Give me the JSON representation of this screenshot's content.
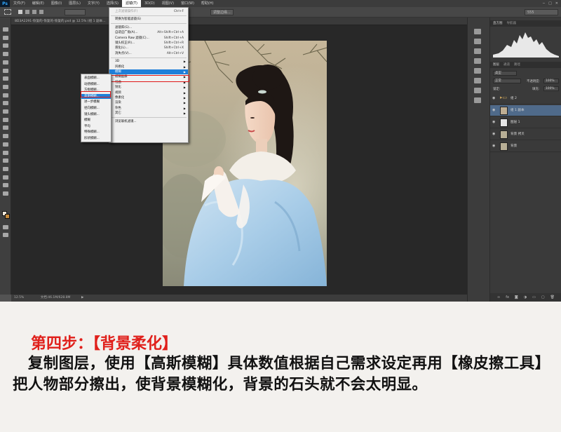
{
  "menubar": {
    "logo": "Ps",
    "items": [
      "文件(F)",
      "编辑(E)",
      "图像(I)",
      "图层(L)",
      "文字(Y)",
      "选择(S)",
      "滤镜(T)",
      "3D(D)",
      "视图(V)",
      "窗口(W)",
      "帮助(H)"
    ],
    "active_index": 6
  },
  "optionsbar": {
    "adjust_edge": "调整边缘...",
    "field_value": "555"
  },
  "document": {
    "tab_title": "8D3A2291-恢复的-恢复的-恢复的.psd @ 12.5% (组 1 副本...",
    "zoom": "12.5%",
    "doc_info": "文档:46.1M/628.8M"
  },
  "filter_menu": {
    "items": [
      {
        "label": "上次滤镜操作(F)",
        "shortcut": "Ctrl+F",
        "dim": true
      },
      {
        "label": "转换为智能滤镜(S)",
        "shortcut": ""
      },
      {
        "label": "滤镜库(G)...",
        "shortcut": ""
      },
      {
        "label": "自适应广角(A)...",
        "shortcut": "Alt+Shift+Ctrl+A"
      },
      {
        "label": "Camera Raw 滤镜(C)...",
        "shortcut": "Shift+Ctrl+A"
      },
      {
        "label": "镜头校正(R)...",
        "shortcut": "Shift+Ctrl+R"
      },
      {
        "label": "液化(L)...",
        "shortcut": "Shift+Ctrl+X"
      },
      {
        "label": "消失点(V)...",
        "shortcut": "Alt+Ctrl+V"
      },
      {
        "label": "3D",
        "shortcut": ""
      },
      {
        "label": "风格化",
        "shortcut": ""
      },
      {
        "label": "模糊",
        "shortcut": ""
      },
      {
        "label": "模糊画廊",
        "shortcut": ""
      },
      {
        "label": "扭曲",
        "shortcut": ""
      },
      {
        "label": "锐化",
        "shortcut": ""
      },
      {
        "label": "视频",
        "shortcut": ""
      },
      {
        "label": "像素化",
        "shortcut": ""
      },
      {
        "label": "渲染",
        "shortcut": ""
      },
      {
        "label": "杂色",
        "shortcut": ""
      },
      {
        "label": "其它",
        "shortcut": ""
      },
      {
        "label": "浏览联机滤镜...",
        "shortcut": ""
      }
    ],
    "highlighted_index": 10
  },
  "blur_submenu": {
    "items": [
      "表面模糊...",
      "动感模糊...",
      "方框模糊...",
      "高斯模糊...",
      "进一步模糊",
      "径向模糊...",
      "镜头模糊...",
      "模糊",
      "平均",
      "特殊模糊...",
      "形状模糊..."
    ],
    "highlighted_index": 3
  },
  "right_panel": {
    "histogram_tabs": [
      "直方图",
      "导航器"
    ],
    "layers_tabs": [
      "图层",
      "通道",
      "路径"
    ],
    "kind": "类型",
    "blend_mode": "正常",
    "opacity_label": "不透明度:",
    "opacity_value": "100%",
    "lock_label": "锁定:",
    "fill_label": "填充:",
    "fill_value": "100%",
    "layers": [
      {
        "name": "组 2",
        "selected": false,
        "group": true
      },
      {
        "name": "组 1 副本",
        "selected": true,
        "group": false
      },
      {
        "name": "图层 1",
        "selected": false,
        "group": false
      },
      {
        "name": "背景 拷贝",
        "selected": false,
        "group": false
      },
      {
        "name": "背景",
        "selected": false,
        "group": false
      }
    ]
  },
  "caption": {
    "step_title": "第四步：【背景柔化】",
    "body": "　复制图层，使用【高斯模糊】具体数值根据自己需求设定再用【橡皮擦工具】把人物部分擦出，使背景模糊化，背景的石头就不会太明显。"
  },
  "colors": {
    "highlight_blue": "#1e7fd9",
    "red_box": "#e01818",
    "step_red": "#e0201b"
  }
}
